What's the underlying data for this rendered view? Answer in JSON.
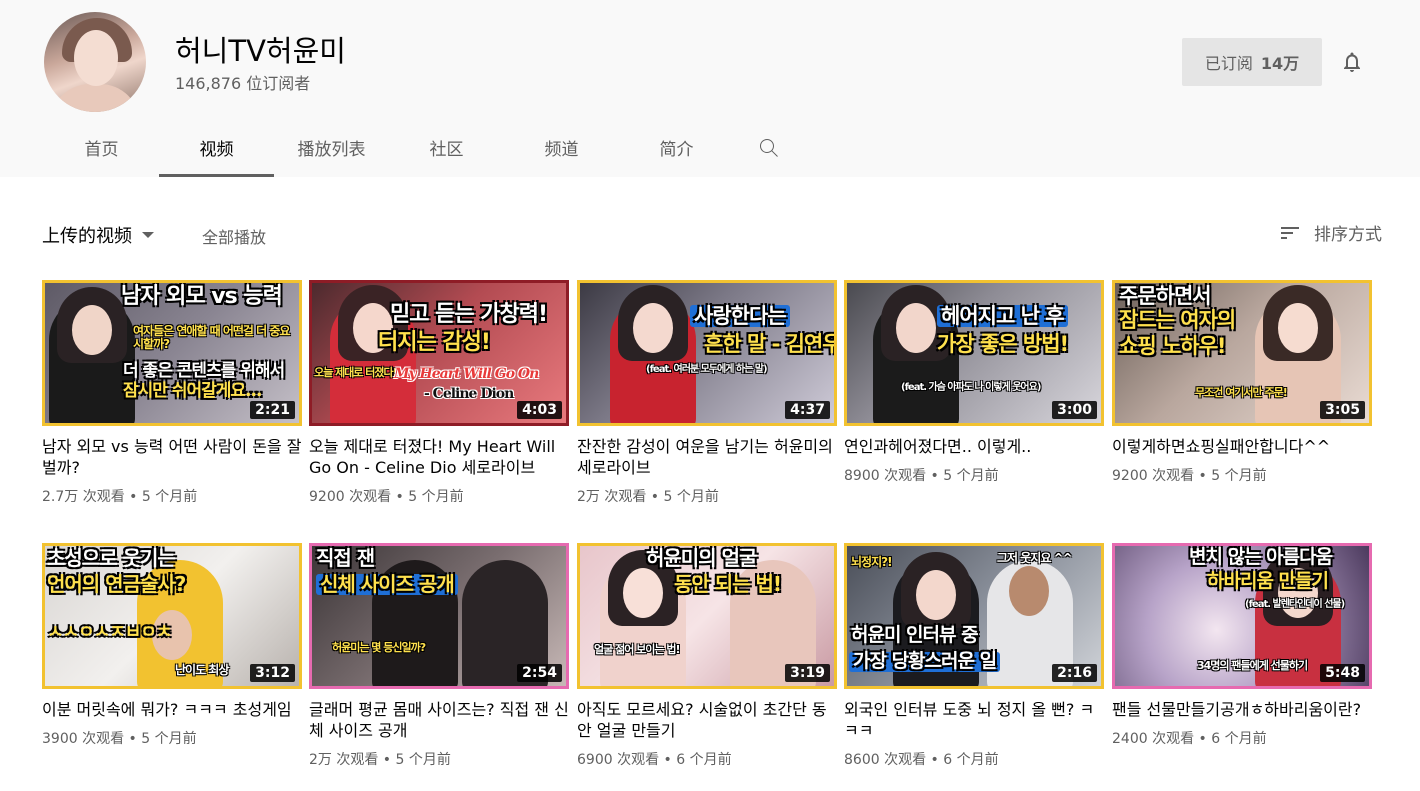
{
  "channel": {
    "name": "허니TV허윤미",
    "subscribers": "146,876 位订阅者",
    "subscribe_label": "已订阅",
    "subscribe_count": "14万"
  },
  "icons": {
    "bell": "bell-icon",
    "search": "search-icon",
    "sort": "sort-icon",
    "dropdown": "chevron-down-icon"
  },
  "tabs": [
    {
      "label": "首页"
    },
    {
      "label": "视频",
      "active": true
    },
    {
      "label": "播放列表"
    },
    {
      "label": "社区"
    },
    {
      "label": "频道"
    },
    {
      "label": "简介"
    }
  ],
  "section": {
    "title": "上传的视频",
    "play_all": "全部播放",
    "sort_label": "排序方式"
  },
  "videos": [
    {
      "title": "남자 외모 vs 능력 어떤 사람이 돈을 잘 벌까?",
      "meta": "2.7万 次观看 • 5 个月前",
      "duration": "2:21",
      "thumb_text": [
        "남자 외모 vs 능력",
        "여자들은 연애할 때 어떤걸 더 중요시할까?",
        "더 좋은 콘텐츠를 위해서",
        "잠시만 쉬어갈게요..."
      ]
    },
    {
      "title": "오늘 제대로 터졌다! My Heart Will Go On - Celine Dio 세로라이브",
      "meta": "9200 次观看 • 5 个月前",
      "duration": "4:03",
      "thumb_text": [
        "믿고 듣는 가창력!",
        "터지는 감성!",
        "오늘 제대로 터졌다!",
        "My Heart Will Go On",
        "- Celine Dion"
      ]
    },
    {
      "title": "잔잔한 감성이 여운을 남기는 허윤미의 세로라이브",
      "meta": "2万 次观看 • 5 个月前",
      "duration": "4:37",
      "thumb_text": [
        "사랑한다는",
        "흔한 말 - 김연우",
        "(feat. 여러분 모두에게 하는 말)"
      ]
    },
    {
      "title": "연인과헤어졌다면.. 이렇게..",
      "meta": "8900 次观看 • 5 个月前",
      "duration": "3:00",
      "thumb_text": [
        "헤어지고 난 후",
        "가장 좋은 방법!",
        "(feat. 가슴 아파도 나 이렇게 웃어요)"
      ]
    },
    {
      "title": "이렇게하면쇼핑실패안합니다^^",
      "meta": "9200 次观看 • 5 个月前",
      "duration": "3:05",
      "thumb_text": [
        "주문하면서",
        "잠드는 여자의",
        "쇼핑 노하우!",
        "무조건 여기서만 주문!"
      ]
    },
    {
      "title": "이분 머릿속에 뭐가? ㅋㅋㅋ 초성게임",
      "meta": "3900 次观看 • 5 个月前",
      "duration": "3:12",
      "thumb_text": [
        "초성으로 웃기는",
        "언어의 연금술사?",
        "ㅅㅅㅇㅅㅈㅂㅇㅊ",
        "난이도 최상"
      ]
    },
    {
      "title": "글래머 평균 몸매 사이즈는? 직접 잰 신체 사이즈 공개",
      "meta": "2万 次观看 • 5 个月前",
      "duration": "2:54",
      "thumb_text": [
        "직접 잰",
        "신체 사이즈 공개",
        "허윤미는 몇 등신일까?"
      ]
    },
    {
      "title": "아직도 모르세요? 시술없이 초간단 동안 얼굴 만들기",
      "meta": "6900 次观看 • 6 个月前",
      "duration": "3:19",
      "thumb_text": [
        "허윤미의 얼굴",
        "동안 되는 법!",
        "얼굴 젊어 보이는 법!"
      ]
    },
    {
      "title": "외국인 인터뷰 도중 뇌 정지 올 뻔? ㅋㅋㅋ",
      "meta": "8600 次观看 • 6 个月前",
      "duration": "2:16",
      "thumb_text": [
        "뇌정지?!",
        "그저 웃지요 ^^",
        "허윤미 인터뷰 중",
        "가장 당황스러운 일"
      ]
    },
    {
      "title": "팬들 선물만들기공개ㅎ하바리움이란?",
      "meta": "2400 次观看 • 6 个月前",
      "duration": "5:48",
      "thumb_text": [
        "변치 않는 아름다움",
        "하바리움 만들기",
        "(feat. 발렌타인데이 선물)",
        "34명의 팬들에게 선물하기"
      ]
    }
  ],
  "colors": {
    "header_bg": "#f9f9f9",
    "thumb_border_gold": "#f2c230",
    "thumb_border_red": "#8e1c26",
    "thumb_border_pink": "#e66ab0",
    "text_secondary": "#606060"
  }
}
